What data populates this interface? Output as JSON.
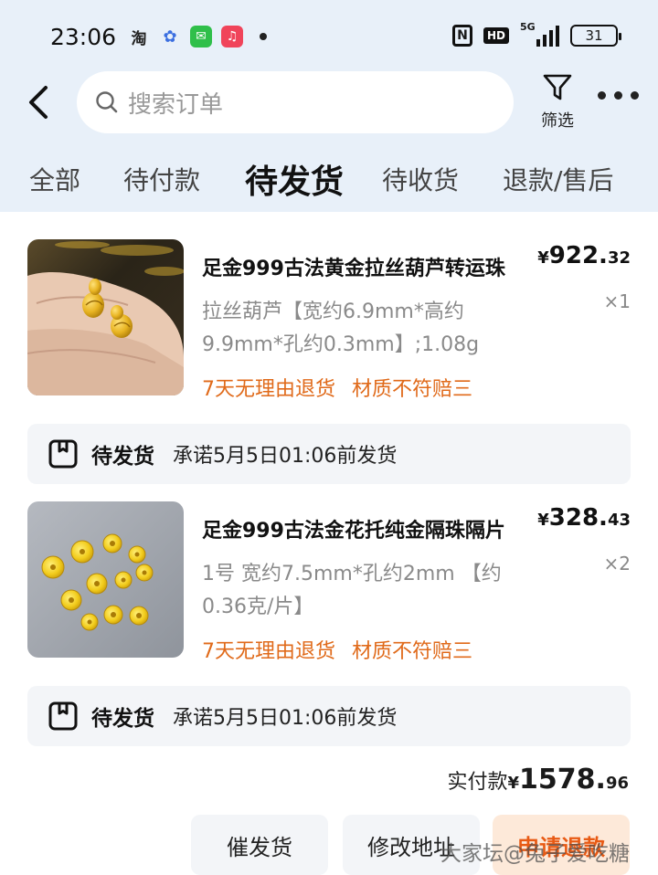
{
  "status_bar": {
    "time": "23:06",
    "app_icons": [
      "taobao-icon",
      "baidu-icon",
      "messages-icon",
      "music-icon"
    ],
    "network": "5G",
    "battery": "31"
  },
  "header": {
    "search_placeholder": "搜索订单",
    "filter_label": "筛选"
  },
  "tabs": [
    {
      "label": "全部",
      "active": false
    },
    {
      "label": "待付款",
      "active": false
    },
    {
      "label": "待发货",
      "active": true
    },
    {
      "label": "待收货",
      "active": false
    },
    {
      "label": "退款/售后",
      "active": false
    }
  ],
  "items": [
    {
      "title": "足金999古法黄金拉丝葫芦转运珠",
      "spec": "拉丝葫芦【宽约6.9mm*高约9.9mm*孔约0.3mm】;1.08g",
      "tags": [
        "7天无理由退货",
        "材质不符赔三"
      ],
      "price_symbol": "¥",
      "price_int": "922.",
      "price_dec": "32",
      "qty": "×1",
      "ship_status": "待发货",
      "ship_promise": "承诺5月5日01:06前发货"
    },
    {
      "title": "足金999古法金花托纯金隔珠隔片",
      "spec": "1号 宽约7.5mm*孔约2mm 【约0.36克/片】",
      "tags": [
        "7天无理由退货",
        "材质不符赔三"
      ],
      "price_symbol": "¥",
      "price_int": "328.",
      "price_dec": "43",
      "qty": "×2",
      "ship_status": "待发货",
      "ship_promise": "承诺5月5日01:06前发货"
    }
  ],
  "total": {
    "label": "实付款",
    "symbol": "¥",
    "int": "1578.",
    "dec": "96"
  },
  "buttons": {
    "urge": "催发货",
    "modify_address": "修改地址",
    "refund": "申请退款"
  },
  "watermark": "大家坛@兔子爱吃糖",
  "colors": {
    "accent_orange": "#e06a1a",
    "page_bg": "#e8f0f9"
  }
}
